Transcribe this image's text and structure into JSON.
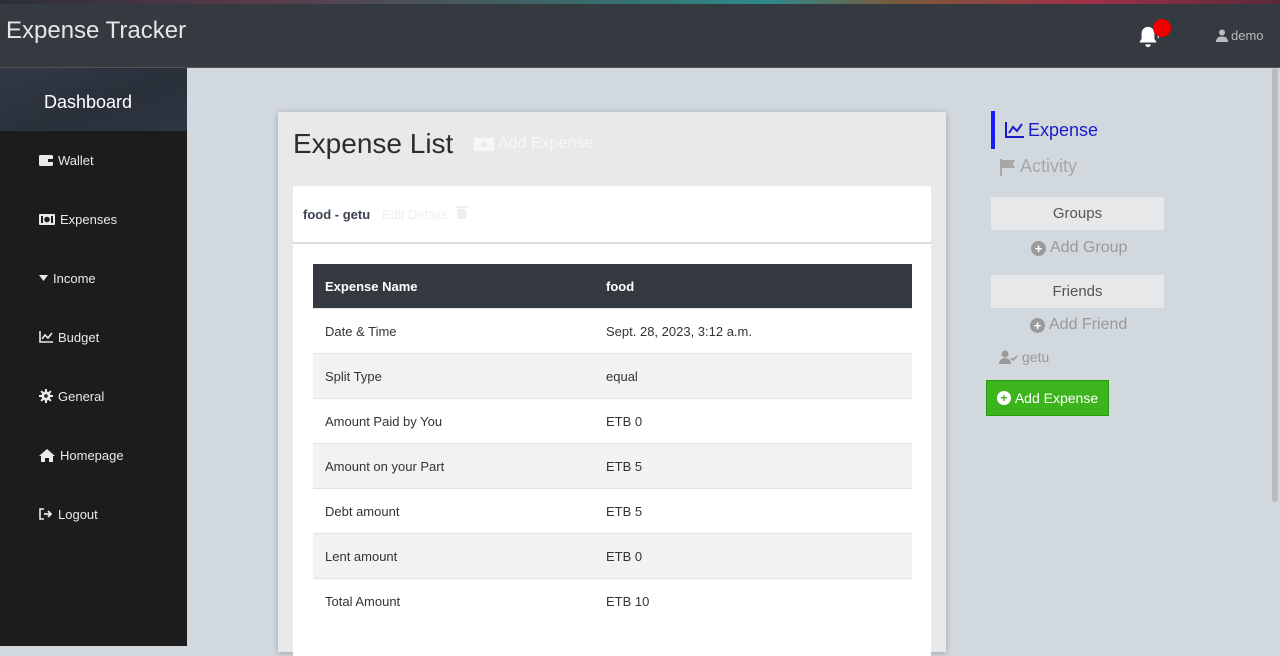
{
  "app": {
    "title": "Expense Tracker",
    "user": "demo"
  },
  "sidebar": {
    "title": "Dashboard",
    "items": [
      {
        "label": "Wallet",
        "icon": "wallet-icon"
      },
      {
        "label": "Expenses",
        "icon": "money-bill-icon"
      },
      {
        "label": "Income",
        "icon": "caret-down-icon"
      },
      {
        "label": "Budget",
        "icon": "chart-line-icon"
      },
      {
        "label": "General",
        "icon": "gear-icon"
      },
      {
        "label": "Homepage",
        "icon": "home-icon"
      },
      {
        "label": "Logout",
        "icon": "logout-icon"
      }
    ]
  },
  "main": {
    "title": "Expense List",
    "add_expense_link": "Add Expense",
    "detail": {
      "title": "food - getu",
      "edit_link": "Edit Details",
      "header": {
        "col1": "Expense Name",
        "col2": "food"
      },
      "rows": [
        {
          "label": "Date & Time",
          "value": "Sept. 28, 2023, 3:12 a.m."
        },
        {
          "label": "Split Type",
          "value": "equal"
        },
        {
          "label": "Amount Paid by You",
          "value": "ETB 0"
        },
        {
          "label": "Amount on your Part",
          "value": "ETB 5"
        },
        {
          "label": "Debt amount",
          "value": "ETB 5"
        },
        {
          "label": "Lent amount",
          "value": "ETB 0"
        },
        {
          "label": "Total Amount",
          "value": "ETB 10"
        }
      ]
    }
  },
  "right": {
    "nav": {
      "expense": "Expense",
      "activity": "Activity"
    },
    "groups_label": "Groups",
    "add_group": "Add Group",
    "friends_label": "Friends",
    "add_friend": "Add Friend",
    "friends": [
      "getu"
    ],
    "add_expense_button": "Add Expense"
  },
  "colors": {
    "navbar": "#343a40",
    "sidebar": "#1c1c1c",
    "accent_blue": "#1a1aff",
    "green_button": "#3cb41c",
    "notification": "#ee0000"
  }
}
